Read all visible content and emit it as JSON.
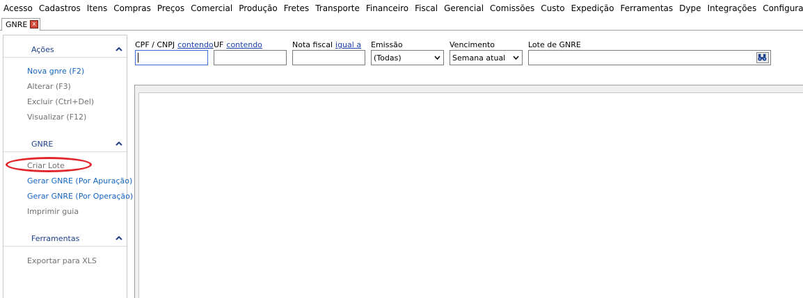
{
  "menu": [
    "Acesso",
    "Cadastros",
    "Itens",
    "Compras",
    "Preços",
    "Comercial",
    "Produção",
    "Fretes",
    "Transporte",
    "Financeiro",
    "Fiscal",
    "Gerencial",
    "Comissões",
    "Custo",
    "Expedição",
    "Ferramentas",
    "Dype",
    "Integrações",
    "Configurações"
  ],
  "tab": {
    "label": "GNRE",
    "close": "x"
  },
  "sidebar": {
    "acoes": {
      "title": "Ações",
      "items": [
        {
          "label": "Nova gnre (F2)",
          "enabled": true
        },
        {
          "label": "Alterar (F3)",
          "enabled": false
        },
        {
          "label": "Excluir (Ctrl+Del)",
          "enabled": false
        },
        {
          "label": "Visualizar (F12)",
          "enabled": false
        }
      ]
    },
    "gnre": {
      "title": "GNRE",
      "items": [
        {
          "label": "Criar Lote",
          "enabled": false
        },
        {
          "label": "Gerar GNRE (Por Apuração)",
          "enabled": true
        },
        {
          "label": "Gerar GNRE (Por Operação)",
          "enabled": true
        },
        {
          "label": "Imprimir guia",
          "enabled": false
        }
      ]
    },
    "ferramentas": {
      "title": "Ferramentas",
      "items": [
        {
          "label": "Exportar para XLS",
          "enabled": false
        }
      ]
    }
  },
  "filters": {
    "cpf": {
      "label": "CPF / CNPJ",
      "mode": "contendo",
      "value": ""
    },
    "uf": {
      "label": "UF",
      "mode": "contendo",
      "value": ""
    },
    "nota": {
      "label": "Nota fiscal",
      "mode": "igual a",
      "value": ""
    },
    "emissao": {
      "label": "Emissão",
      "value": "(Todas)"
    },
    "vencimento": {
      "label": "Vencimento",
      "value": "Semana atual"
    },
    "lote": {
      "label": "Lote de GNRE",
      "value": ""
    }
  },
  "colors": {
    "accent_link": "#1565c0",
    "header_text": "#1d3f8a",
    "highlight_ellipse": "#e2262b"
  }
}
